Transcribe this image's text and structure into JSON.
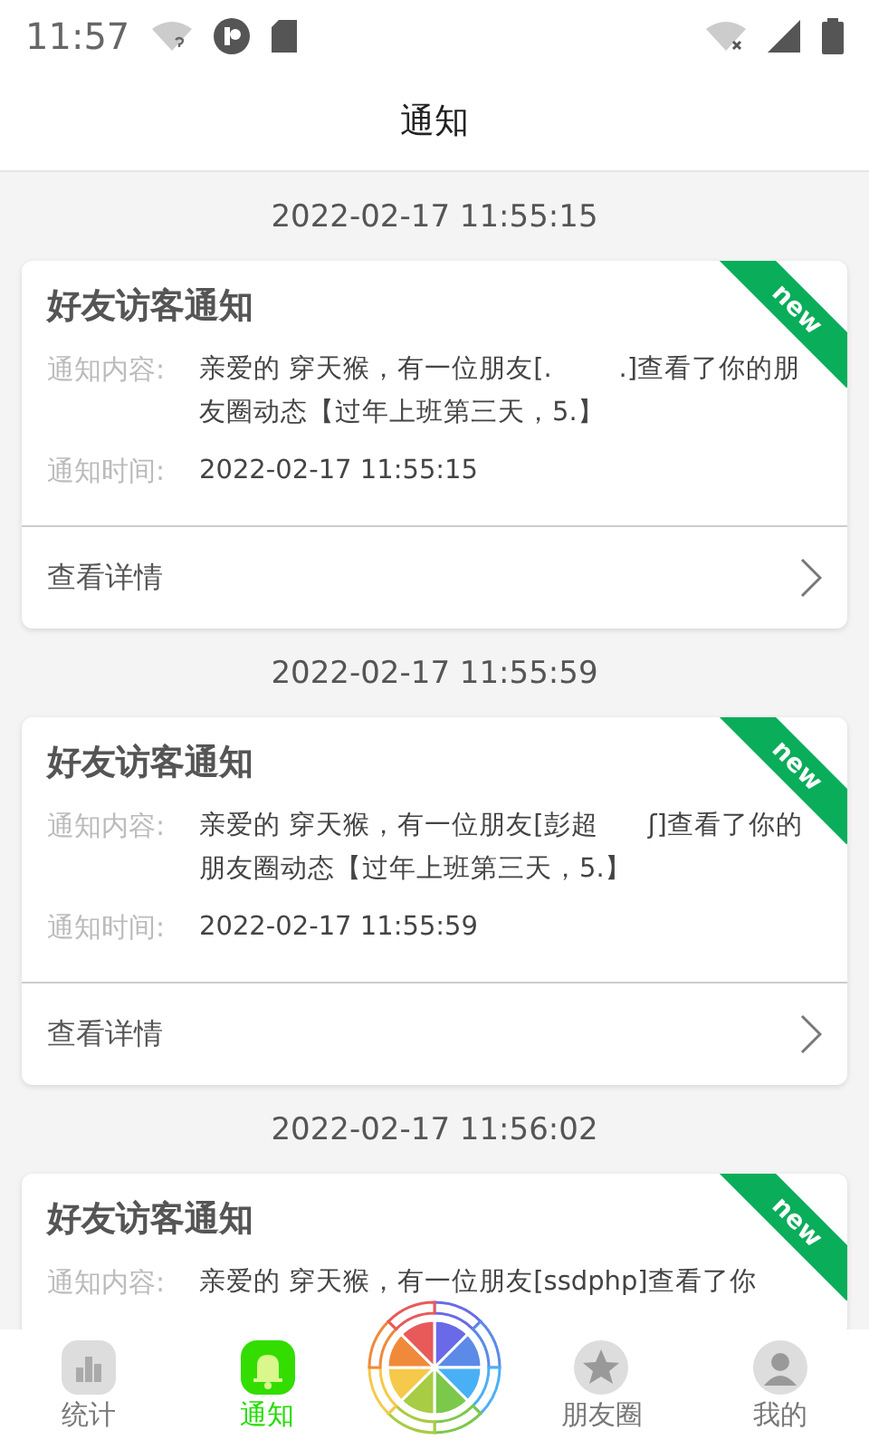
{
  "status_bar": {
    "time": "11:57"
  },
  "header": {
    "title": "通知"
  },
  "notifications": [
    {
      "date": "2022-02-17 11:55:15",
      "title": "好友访客通知",
      "is_new": true,
      "badge": "new",
      "content_label": "通知内容:",
      "content": "亲爱的 穿天猴，有一位朋友[.        .]查看了你的朋友圈动态【过年上班第三天，5.】",
      "time_label": "通知时间:",
      "time": "2022-02-17 11:55:15",
      "action": "查看详情"
    },
    {
      "date": "2022-02-17 11:55:59",
      "title": "好友访客通知",
      "is_new": true,
      "badge": "new",
      "content_label": "通知内容:",
      "content": "亲爱的 穿天猴，有一位朋友[彭超      ʃ]查看了你的朋友圈动态【过年上班第三天，5.】",
      "time_label": "通知时间:",
      "time": "2022-02-17 11:55:59",
      "action": "查看详情"
    },
    {
      "date": "2022-02-17 11:56:02",
      "title": "好友访客通知",
      "is_new": true,
      "badge": "new",
      "content_label": "通知内容:",
      "content": "亲爱的 穿天猴，有一位朋友[ssdphp]查看了你"
    }
  ],
  "tab_bar": [
    {
      "kind": "stats",
      "label": "统计",
      "selected": false
    },
    {
      "kind": "bell",
      "label": "通知",
      "selected": true
    },
    {
      "kind": "wheel"
    },
    {
      "kind": "star",
      "label": "朋友圈",
      "selected": false
    },
    {
      "kind": "person",
      "label": "我的",
      "selected": false
    }
  ]
}
